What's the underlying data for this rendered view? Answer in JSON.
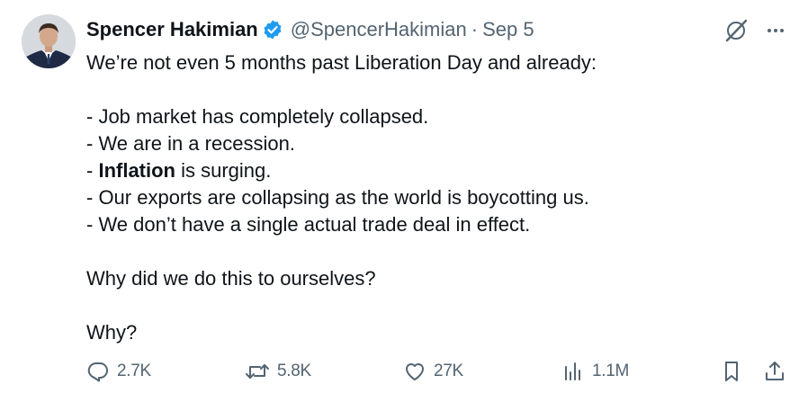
{
  "tweet": {
    "author_name": "Spencer Hakimian",
    "handle": "@SpencerHakimian",
    "separator": "·",
    "date": "Sep 5",
    "lines": {
      "l1": "We’re not even 5 months past Liberation Day and already:",
      "l2": "- Job market has completely collapsed.",
      "l3": "- We are in a recession.",
      "l4_prefix": "- ",
      "l4_bold": "Inflation",
      "l4_rest": " is surging.",
      "l5": "- Our exports are collapsing as the world is boycotting us.",
      "l6": "- We don’t have a single actual trade deal in effect.",
      "l7": "Why did we do this to ourselves?",
      "l8": "Why?"
    }
  },
  "metrics": {
    "replies": "2.7K",
    "reposts": "5.8K",
    "likes": "27K",
    "views": "1.1M"
  },
  "colors": {
    "text": "#0f1419",
    "muted": "#536471",
    "verified": "#1d9bf0"
  }
}
